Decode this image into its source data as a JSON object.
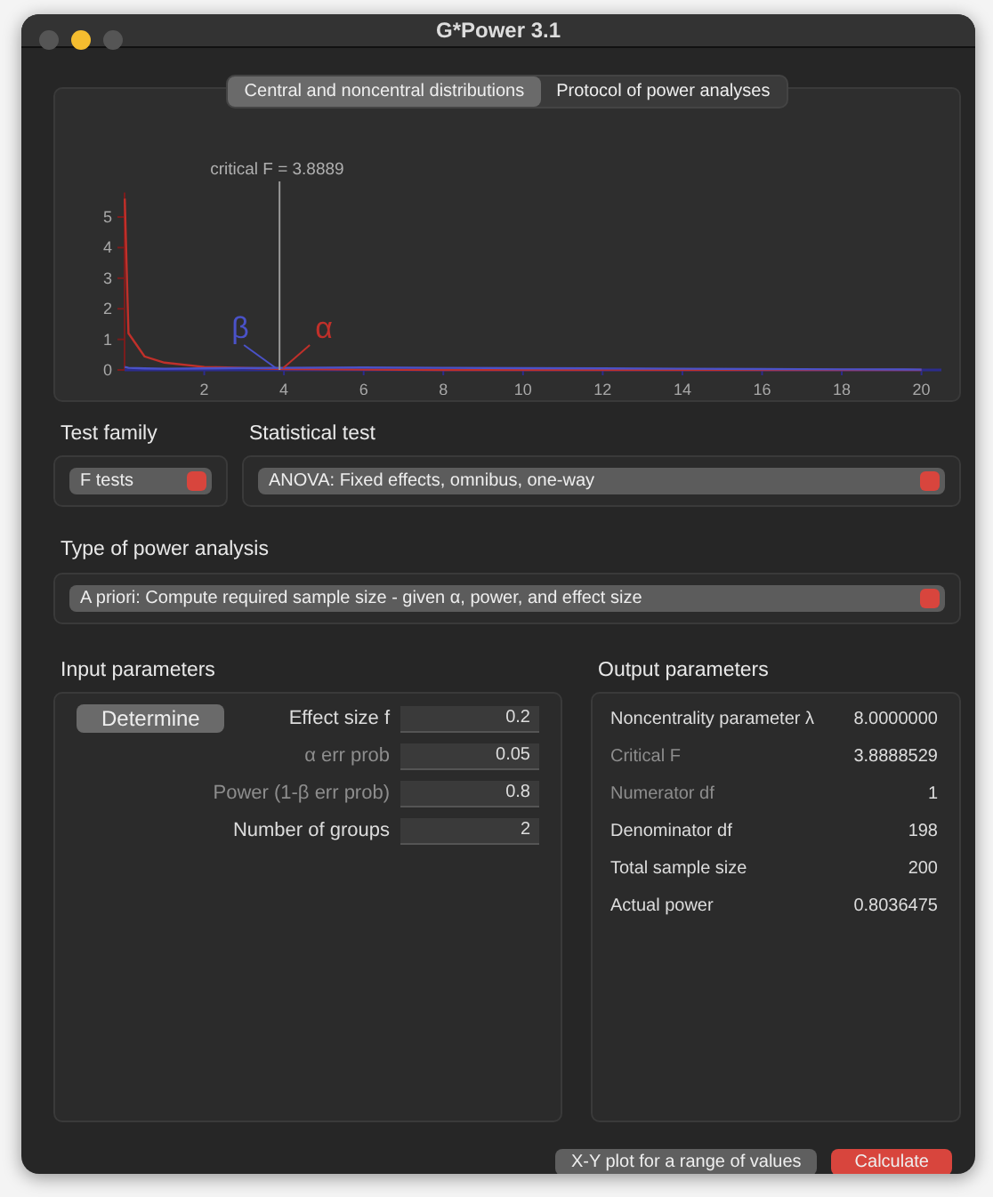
{
  "window": {
    "title": "G*Power 3.1"
  },
  "tabs": [
    {
      "label": "Central and noncentral distributions",
      "selected": true
    },
    {
      "label": "Protocol of power analyses",
      "selected": false
    }
  ],
  "chart_data": {
    "type": "line",
    "x": [
      0.005,
      0.1,
      0.5,
      1,
      2,
      4,
      6,
      8,
      10,
      12,
      14,
      16,
      18,
      20
    ],
    "series": [
      {
        "color": "#c0302a",
        "values": [
          5.6,
          1.2,
          0.44,
          0.24,
          0.1,
          0.03,
          0.01,
          0,
          0,
          0,
          0,
          0,
          0,
          0
        ]
      },
      {
        "color": "#4a52c8",
        "values": [
          0.1,
          0.07,
          0.05,
          0.04,
          0.05,
          0.07,
          0.08,
          0.07,
          0.06,
          0.05,
          0.04,
          0.03,
          0.02,
          0.01
        ]
      }
    ],
    "xlim": [
      0,
      20.5
    ],
    "ylim": [
      0,
      5.8
    ],
    "xticks": [
      2,
      4,
      6,
      8,
      10,
      12,
      14,
      16,
      18,
      20
    ],
    "yticks": [
      0,
      1,
      2,
      3,
      4,
      5
    ],
    "ref_lines": [
      {
        "axis": "x",
        "value": 3.8889,
        "label": "critical F = 3.8889"
      }
    ],
    "annotations": [
      {
        "text": "β"
      },
      {
        "text": "α"
      }
    ]
  },
  "test_family": {
    "label": "Test family",
    "value": "F tests"
  },
  "statistical_test": {
    "label": "Statistical test",
    "value": "ANOVA: Fixed effects, omnibus, one-way"
  },
  "power_analysis": {
    "label": "Type of power analysis",
    "value": "A priori: Compute required sample size - given α, power, and effect size"
  },
  "input_parameters": {
    "title": "Input parameters",
    "determine": "Determine",
    "fields": [
      {
        "label": "Effect size f",
        "value": "0.2",
        "dimmed": false
      },
      {
        "label": "α err prob",
        "value": "0.05",
        "dimmed": true
      },
      {
        "label": "Power (1-β err prob)",
        "value": "0.8",
        "dimmed": true
      },
      {
        "label": "Number of groups",
        "value": "2",
        "dimmed": false
      }
    ]
  },
  "output_parameters": {
    "title": "Output parameters",
    "rows": [
      {
        "label": "Noncentrality parameter λ",
        "value": "8.0000000",
        "dimmed": false
      },
      {
        "label": "Critical F",
        "value": "3.8888529",
        "dimmed": true
      },
      {
        "label": "Numerator df",
        "value": "1",
        "dimmed": true
      },
      {
        "label": "Denominator df",
        "value": "198",
        "dimmed": false
      },
      {
        "label": "Total sample size",
        "value": "200",
        "dimmed": false
      },
      {
        "label": "Actual power",
        "value": "0.8036475",
        "dimmed": false
      }
    ]
  },
  "buttons": [
    {
      "label": "X-Y plot for a range of values",
      "kind": "secondary"
    },
    {
      "label": "Calculate",
      "kind": "primary"
    }
  ]
}
